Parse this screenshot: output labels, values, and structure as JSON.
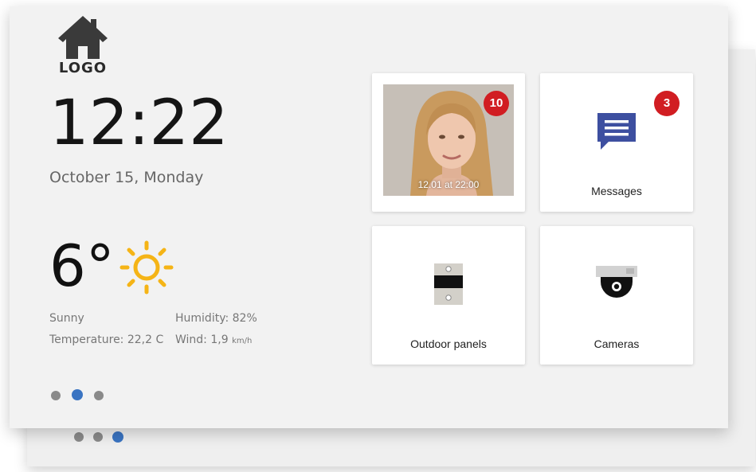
{
  "logo": {
    "text": "LOGO",
    "icon": "house-icon"
  },
  "clock": {
    "time": "12:22",
    "date": "October 15, Monday"
  },
  "weather": {
    "temperature": "6°",
    "icon": "sun-icon",
    "condition": "Sunny",
    "humidity": "Humidity: 82%",
    "temperature_detail": "Temperature: 22,2 C",
    "wind_label": "Wind: 1,9 ",
    "wind_unit": "km/h"
  },
  "pagination": {
    "front_active": 1,
    "back_active": 2,
    "count": 3
  },
  "tiles": {
    "visitor": {
      "badge": "10",
      "caption": "12.01 at 22:00"
    },
    "messages": {
      "badge": "3",
      "label": "Messages",
      "icon": "message-icon"
    },
    "outdoor_panels": {
      "label": "Outdoor panels",
      "icon": "intercom-panel-icon"
    },
    "cameras": {
      "label": "Cameras",
      "icon": "dome-camera-icon"
    }
  },
  "colors": {
    "accent": "#3a74c2",
    "badge": "#d11d22",
    "sun": "#f5b416",
    "message_icon": "#3d4fa0"
  }
}
